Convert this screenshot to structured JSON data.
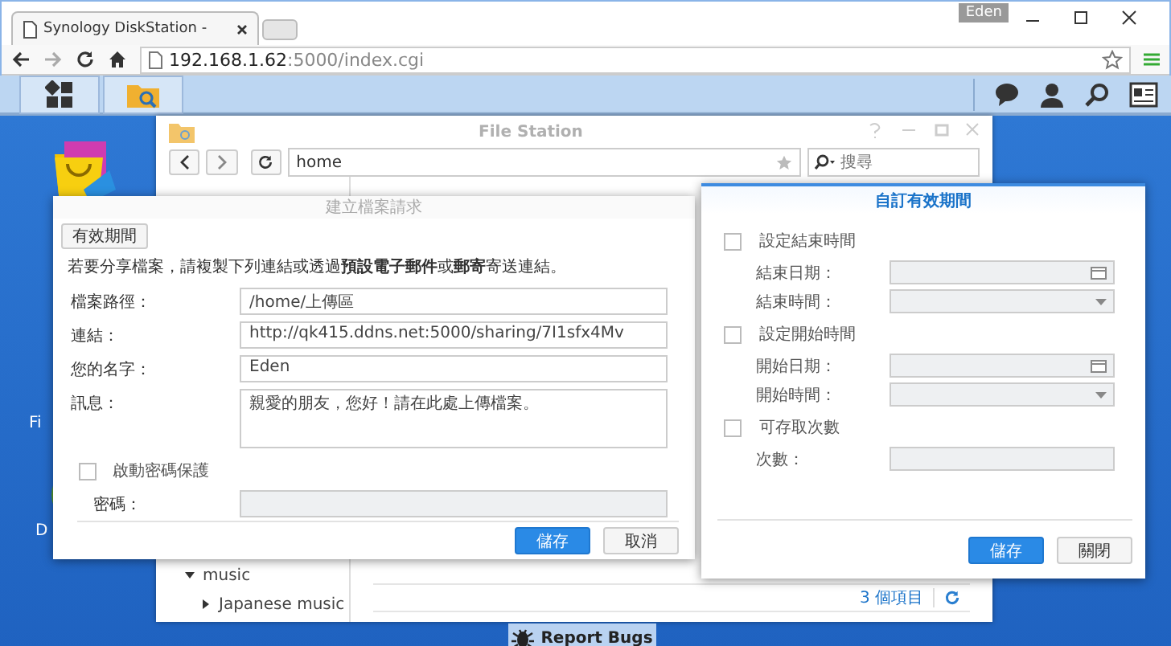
{
  "browser": {
    "tab_title": "Synology DiskStation - ",
    "user_badge": "Eden",
    "url_host": "192.168.1.62",
    "url_rest": ":5000/index.cgi"
  },
  "desktop_labels": [
    "Fi",
    "D"
  ],
  "file_station": {
    "title": "File Station",
    "path": "home",
    "search_placeholder": "搜尋",
    "tree": [
      {
        "label": "music",
        "expanded": true,
        "children": [
          {
            "label": "Japanese music",
            "expanded": false
          }
        ]
      }
    ],
    "item_count": "3 個項目"
  },
  "share_dialog": {
    "title": "建立檔案請求",
    "tab_button": "有效期間",
    "intro": "若要分享檔案，請複製下列連結或透過**預設電子郵件**或**郵寄**寄送連結。",
    "fields": [
      {
        "label": "檔案路徑：",
        "value": "/home/上傳區",
        "kind": "text"
      },
      {
        "label": "連結：",
        "value": "http://qk415.ddns.net:5000/sharing/7I1sfx4Mv",
        "kind": "text"
      },
      {
        "label": "您的名字：",
        "value": "Eden",
        "kind": "text"
      },
      {
        "label": "訊息：",
        "value": "親愛的朋友，您好！請在此處上傳檔案。",
        "kind": "textarea"
      }
    ],
    "password": {
      "label": "啟動密碼保護",
      "checked": false,
      "field_label": "密碼："
    },
    "buttons": [
      {
        "label": "儲存",
        "primary": true
      },
      {
        "label": "取消",
        "primary": false
      }
    ]
  },
  "validity_dialog": {
    "title": "自訂有效期間",
    "sections": [
      {
        "label": "設定結束時間",
        "checked": false,
        "fields": [
          {
            "label": "結束日期：",
            "kind": "date"
          },
          {
            "label": "結束時間：",
            "kind": "time"
          }
        ]
      },
      {
        "label": "設定開始時間",
        "checked": false,
        "fields": [
          {
            "label": "開始日期：",
            "kind": "date"
          },
          {
            "label": "開始時間：",
            "kind": "time"
          }
        ]
      },
      {
        "label": "可存取次數",
        "checked": false,
        "fields": [
          {
            "label": "次數：",
            "kind": "text"
          }
        ]
      }
    ],
    "buttons": [
      {
        "label": "儲存",
        "primary": true
      },
      {
        "label": "關閉",
        "primary": false
      }
    ]
  },
  "report_bugs": "Report Bugs"
}
